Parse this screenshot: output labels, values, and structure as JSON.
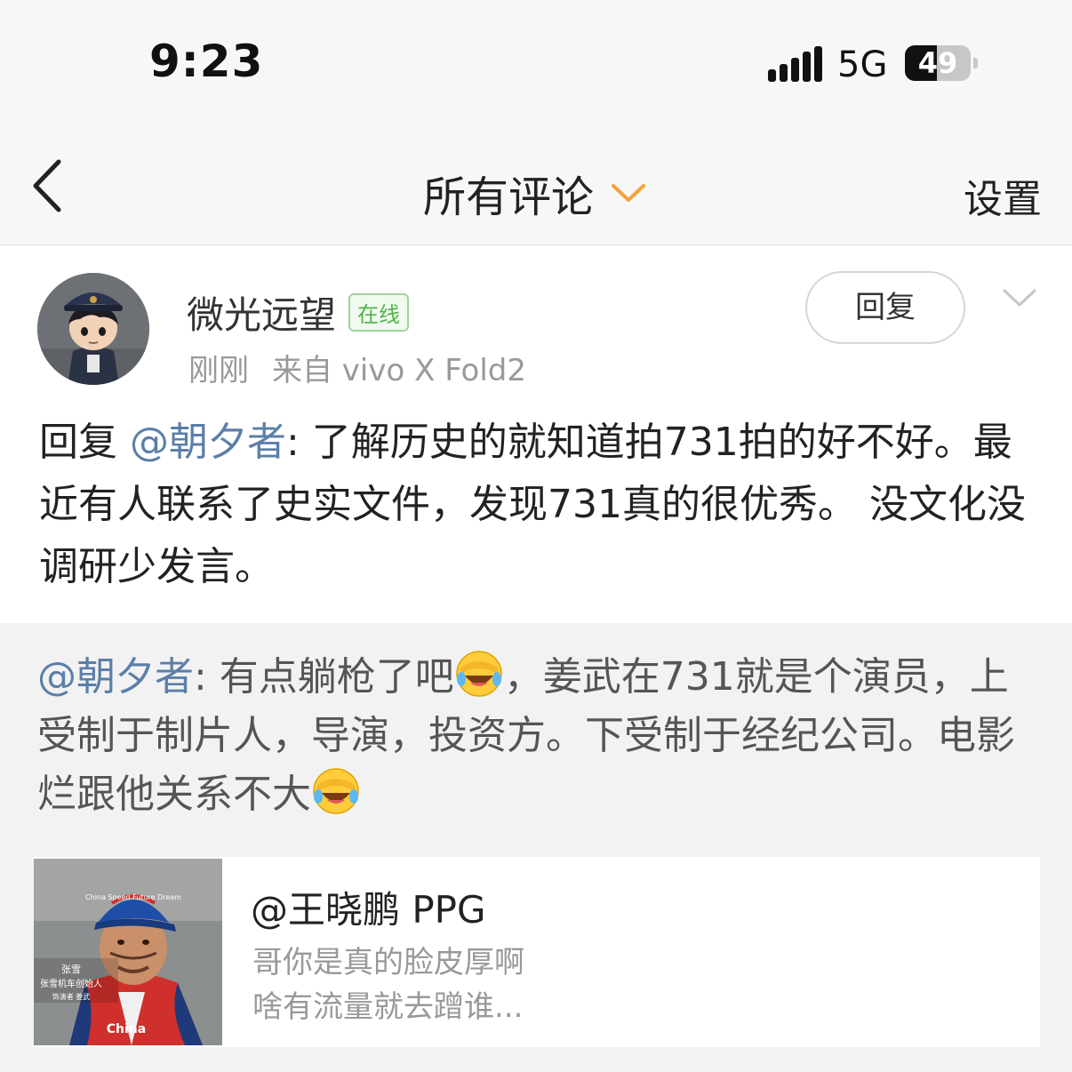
{
  "status_bar": {
    "time": "9:23",
    "network": "5G",
    "battery_percent": "49",
    "battery_level": 0.49
  },
  "nav": {
    "title": "所有评论",
    "settings_label": "设置",
    "back_icon": "chevron-left-icon",
    "dropdown_icon": "chevron-down-icon",
    "accent_color": "#f5a33a"
  },
  "comment": {
    "user_name": "微光远望",
    "online_badge": "在线",
    "time": "刚刚",
    "source": "来自 vivo X Fold2",
    "reply_button": "回复",
    "body_prefix": "回复 ",
    "body_mention": "@朝夕者",
    "body_text": ": 了解历史的就知道拍731拍的好不好。最近有人联系了史实文件，发现731真的很优秀。 没文化没调研少发言。",
    "mention_color": "#5b7fa8"
  },
  "quoted": {
    "mention": "@朝夕者",
    "text_1": ": 有点躺枪了吧",
    "text_2": "，姜武在731就是个演员，上受制于制片人，导演，投资方。下受制于经纪公司。电影烂跟他关系不大",
    "emoji_icon": "facepalm-laugh-emoji"
  },
  "card": {
    "title": "@王晓鹏 PPG",
    "desc_line1": "哥你是真的脸皮厚啊",
    "desc_line2": "啥有流量就去蹭谁...",
    "thumb_caption_name": "张雪",
    "thumb_caption_role": "张雪机车创始人",
    "thumb_caption_actor": "饰演者 姜武",
    "thumb_cap_text": "China Speed Future Dream",
    "thumb_jacket_text": "China"
  }
}
